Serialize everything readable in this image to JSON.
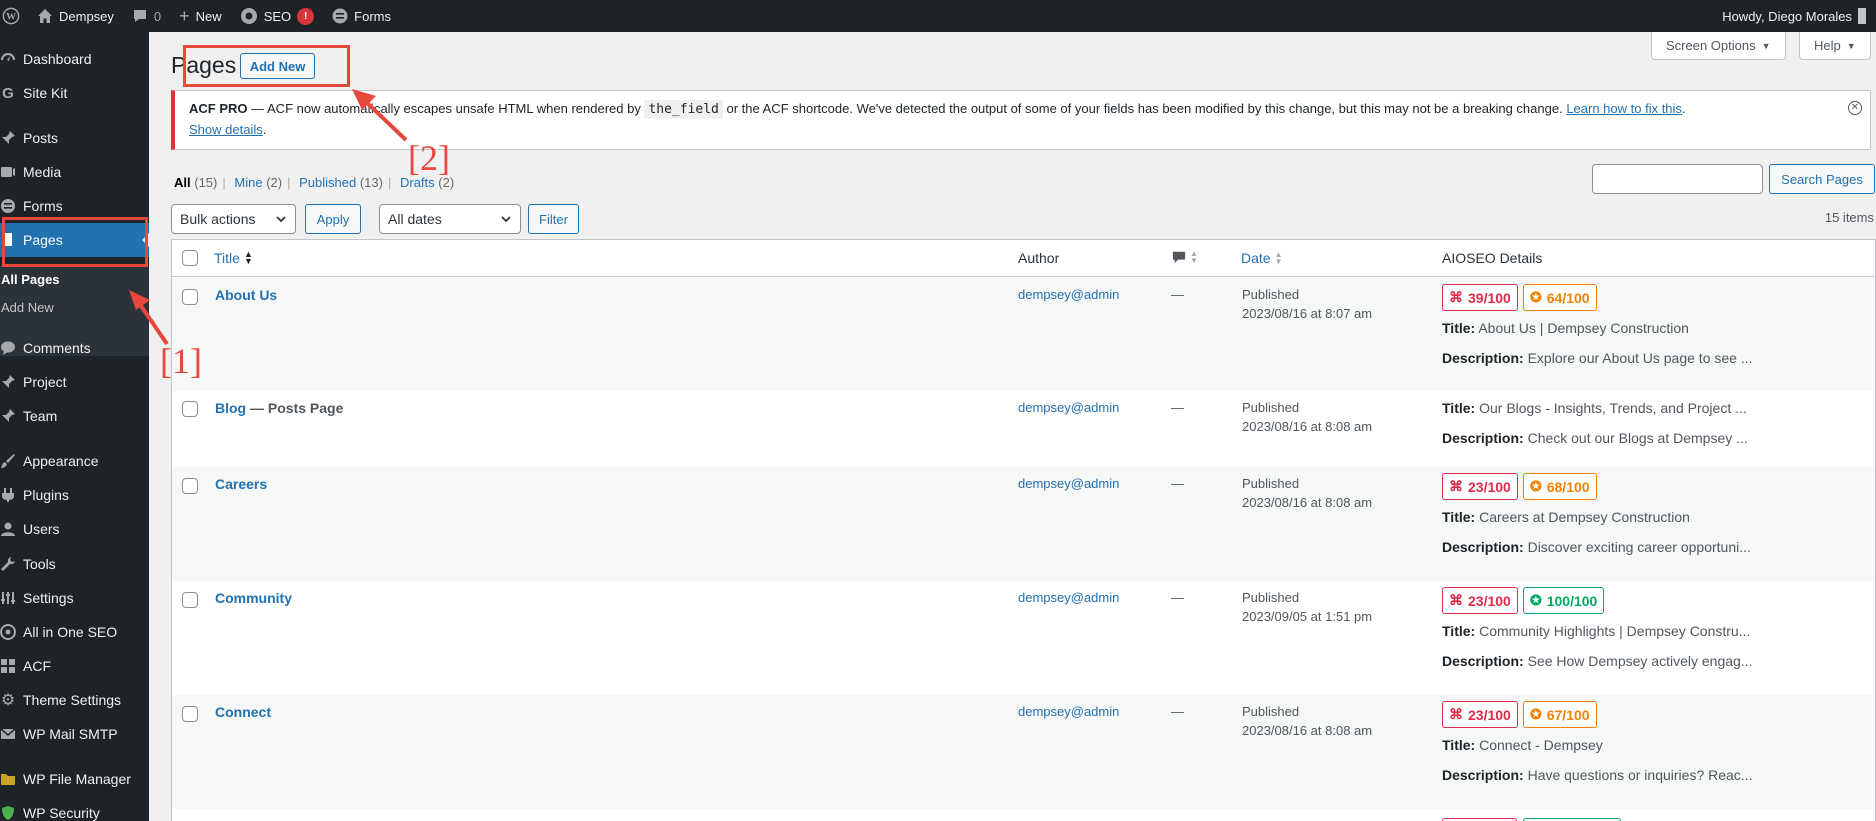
{
  "admin_bar": {
    "site_name": "Dempsey",
    "comments_count": "0",
    "new_label": "New",
    "seo_label": "SEO",
    "seo_badge": "!",
    "forms_label": "Forms",
    "greeting": "Howdy, Diego Morales"
  },
  "sidebar": {
    "items": [
      {
        "label": "Dashboard",
        "icon": "dashboard-icon"
      },
      {
        "label": "Site Kit",
        "icon": "sitekit-icon"
      },
      {
        "label": "Posts",
        "icon": "pin-icon"
      },
      {
        "label": "Media",
        "icon": "media-icon"
      },
      {
        "label": "Forms",
        "icon": "forms-icon"
      },
      {
        "label": "Pages",
        "icon": "page-icon"
      },
      {
        "label": "Comments",
        "icon": "comment-icon"
      },
      {
        "label": "Project",
        "icon": "pin-icon"
      },
      {
        "label": "Team",
        "icon": "pin-icon"
      },
      {
        "label": "Appearance",
        "icon": "brush-icon"
      },
      {
        "label": "Plugins",
        "icon": "plugin-icon"
      },
      {
        "label": "Users",
        "icon": "user-icon"
      },
      {
        "label": "Tools",
        "icon": "wrench-icon"
      },
      {
        "label": "Settings",
        "icon": "settings-icon"
      },
      {
        "label": "All in One SEO",
        "icon": "aioseo-icon"
      },
      {
        "label": "ACF",
        "icon": "acf-icon"
      },
      {
        "label": "Theme Settings",
        "icon": "gear-icon"
      },
      {
        "label": "WP Mail SMTP",
        "icon": "mail-icon"
      },
      {
        "label": "WP File Manager",
        "icon": "folder-icon"
      },
      {
        "label": "WP Security",
        "icon": "shield-icon"
      }
    ],
    "submenu": {
      "all_pages": "All Pages",
      "add_new": "Add New"
    }
  },
  "header": {
    "title": "Pages",
    "add_new": "Add New",
    "screen_options": "Screen Options",
    "help": "Help"
  },
  "notice": {
    "bold": "ACF PRO",
    "text_1": " — ACF now automatically escapes unsafe HTML when rendered by ",
    "code": "the_field",
    "text_2": " or the ACF shortcode. We've detected the output of some of your fields has been modified by this change, but this may not be a breaking change. ",
    "link": "Learn how to fix this",
    "show_details": "Show details"
  },
  "filters": {
    "all": "All",
    "all_count": "(15)",
    "mine": "Mine",
    "mine_count": "(2)",
    "published": "Published",
    "published_count": "(13)",
    "drafts": "Drafts",
    "drafts_count": "(2)",
    "bulk_actions": "Bulk actions",
    "apply": "Apply",
    "all_dates": "All dates",
    "filter": "Filter",
    "search_button": "Search Pages",
    "items_count": "15 items"
  },
  "table": {
    "columns": {
      "title": "Title",
      "author": "Author",
      "date": "Date",
      "aioseo": "AIOSEO Details"
    },
    "title_label": "Title:",
    "description_label": "Description:",
    "rows": [
      {
        "title": "About Us",
        "state": "",
        "author": "dempsey@admin",
        "comments": "—",
        "status": "Published",
        "date": "2023/08/16 at 8:07 am",
        "score_1": "39/100",
        "score_2": "64/100",
        "score_2_color": "orange",
        "seo_title": "About Us | Dempsey Construction",
        "seo_desc": "Explore our About Us page to see ..."
      },
      {
        "title": "Blog",
        "state": " — Posts Page",
        "author": "dempsey@admin",
        "comments": "—",
        "status": "Published",
        "date": "2023/08/16 at 8:08 am",
        "score_1": "",
        "score_2": "",
        "score_2_color": "",
        "seo_title": "Our Blogs - Insights, Trends, and Project ...",
        "seo_desc": "Check out our Blogs at Dempsey ..."
      },
      {
        "title": "Careers",
        "state": "",
        "author": "dempsey@admin",
        "comments": "—",
        "status": "Published",
        "date": "2023/08/16 at 8:08 am",
        "score_1": "23/100",
        "score_2": "68/100",
        "score_2_color": "orange",
        "seo_title": "Careers at Dempsey Construction",
        "seo_desc": "Discover exciting career opportuni..."
      },
      {
        "title": "Community",
        "state": "",
        "author": "dempsey@admin",
        "comments": "—",
        "status": "Published",
        "date": "2023/09/05 at 1:51 pm",
        "score_1": "23/100",
        "score_2": "100/100",
        "score_2_color": "green",
        "seo_title": "Community Highlights | Dempsey Constru...",
        "seo_desc": "See How Dempsey actively engag..."
      },
      {
        "title": "Connect",
        "state": "",
        "author": "dempsey@admin",
        "comments": "—",
        "status": "Published",
        "date": "2023/08/16 at 8:08 am",
        "score_1": "23/100",
        "score_2": "67/100",
        "score_2_color": "orange",
        "seo_title": "Connect - Dempsey",
        "seo_desc": "Have questions or inquiries? Reac..."
      }
    ]
  },
  "annotations": {
    "label_1": "[1]",
    "label_2": "[2]",
    "color": "#e8473c"
  },
  "colors": {
    "admin_dark": "#1d2327",
    "accent": "#2271b1",
    "error": "#d63638"
  }
}
